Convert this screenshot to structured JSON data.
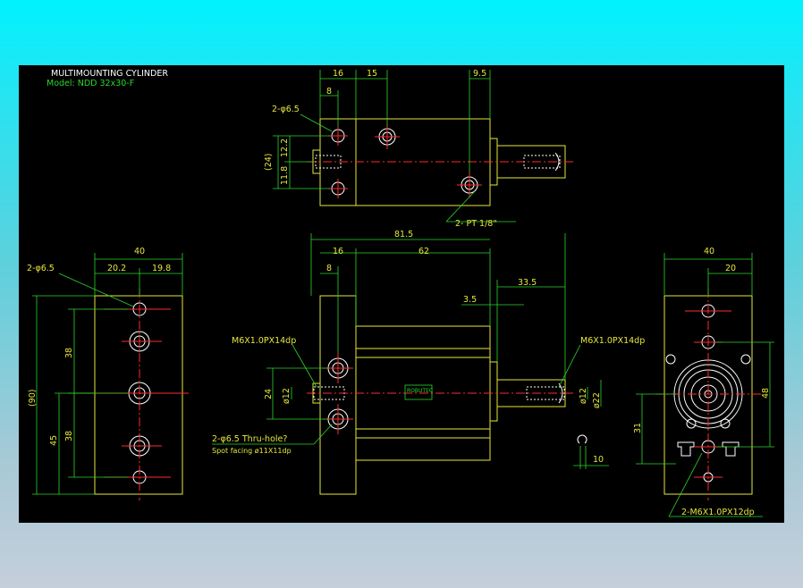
{
  "drawing": {
    "title": "MULTIMOUNTING CYLINDER",
    "model": "Model: NDD 32x30-F"
  },
  "top_view": {
    "dim_16": "16",
    "dim_15": "15",
    "dim_9_5": "9.5",
    "dim_8": "8",
    "hole_callout": "2-φ6.5",
    "dim_24": "(24)",
    "dim_12_2": "12.2",
    "dim_11_8": "11.8",
    "port_callout": "2- PT 1/8\""
  },
  "left_view": {
    "dim_40": "40",
    "dim_20_2": "20.2",
    "dim_19_8": "19.8",
    "hole_callout": "2-φ6.5",
    "dim_90": "(90)",
    "dim_38a": "38",
    "dim_38b": "38",
    "dim_45": "45"
  },
  "front_view": {
    "dim_81_5": "81.5",
    "dim_16": "16",
    "dim_62": "62",
    "dim_8": "8",
    "dim_33_5": "33.5",
    "dim_3_5": "3.5",
    "thread_left": "M6X1.0PX14dp",
    "thread_right": "M6X1.0PX14dp",
    "dim_24": "24",
    "dia_12_left": "ø12",
    "dia_12_right": "ø12",
    "dia_22": "ø22",
    "hole_callout": "2-φ6.5 Thru-hole?",
    "spot_facing": "Spot facing   ø11X11dp",
    "dim_10": "10",
    "brand": "ROBUTEC"
  },
  "right_view": {
    "dim_40": "40",
    "dim_20": "20",
    "dim_48": "48",
    "dim_31": "31",
    "thread_callout": "2-M6X1.0PX12dp"
  },
  "colors": {
    "background_top": "#00f2ff",
    "background_bottom": "#c4cfdb",
    "sheet": "#000000",
    "outline": "#e6e63c",
    "centerline": "#ff2a2a",
    "dimension": "#2bd62b",
    "text": "#ffffff"
  }
}
